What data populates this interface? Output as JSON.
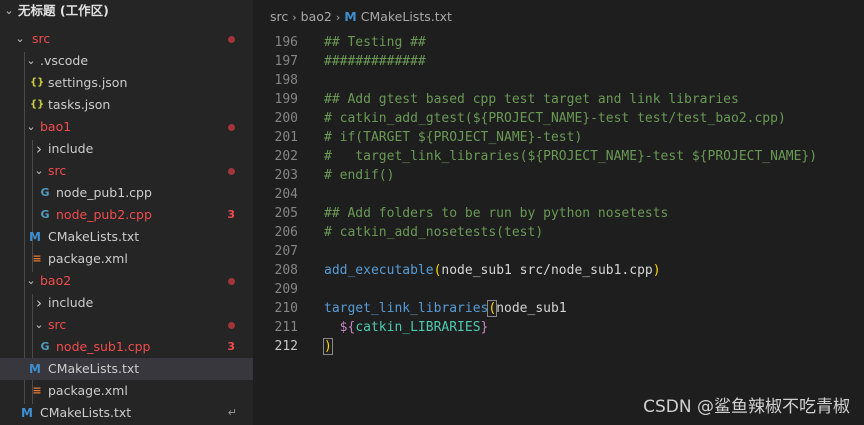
{
  "explorer": {
    "workspace_label": "无标题 (工作区)",
    "items": [
      {
        "label": "src",
        "color": "#f14c4c",
        "marker": "dot"
      },
      {
        "label": ".vscode"
      },
      {
        "label": "settings.json",
        "icon": "{ }"
      },
      {
        "label": "tasks.json",
        "icon": "{ }"
      },
      {
        "label": "bao1",
        "color": "#f14c4c",
        "marker": "dot"
      },
      {
        "label": "include"
      },
      {
        "label": "src",
        "color": "#f14c4c",
        "marker": "dot"
      },
      {
        "label": "node_pub1.cpp",
        "icon": "C"
      },
      {
        "label": "node_pub2.cpp",
        "icon": "C",
        "color": "#f14c4c",
        "badge": "3"
      },
      {
        "label": "CMakeLists.txt",
        "icon": "M"
      },
      {
        "label": "package.xml",
        "icon": "rss"
      },
      {
        "label": "bao2",
        "color": "#f14c4c",
        "marker": "dot"
      },
      {
        "label": "include"
      },
      {
        "label": "src",
        "color": "#f14c4c",
        "marker": "dot"
      },
      {
        "label": "node_sub1.cpp",
        "icon": "C",
        "color": "#f14c4c",
        "badge": "3"
      },
      {
        "label": "CMakeLists.txt",
        "icon": "M",
        "selected": true
      },
      {
        "label": "package.xml",
        "icon": "rss"
      },
      {
        "label": "CMakeLists.txt",
        "icon": "M",
        "trailing": "symlink"
      }
    ]
  },
  "breadcrumb": {
    "part1": "src",
    "part2": "bao2",
    "file": "CMakeLists.txt"
  },
  "code": [
    {
      "n": "196",
      "text": "## Testing ##"
    },
    {
      "n": "197",
      "text": "#############"
    },
    {
      "n": "198",
      "text": ""
    },
    {
      "n": "199",
      "text": "## Add gtest based cpp test target and link libraries"
    },
    {
      "n": "200",
      "text": "# catkin_add_gtest(${PROJECT_NAME}-test test/test_bao2.cpp)"
    },
    {
      "n": "201",
      "text": "# if(TARGET ${PROJECT_NAME}-test)"
    },
    {
      "n": "202",
      "text": "#   target_link_libraries(${PROJECT_NAME}-test ${PROJECT_NAME})"
    },
    {
      "n": "203",
      "text": "# endif()"
    },
    {
      "n": "204",
      "text": ""
    },
    {
      "n": "205",
      "text": "## Add folders to be run by python nosetests"
    },
    {
      "n": "206",
      "text": "# catkin_add_nosetests(test)"
    },
    {
      "n": "207",
      "text": ""
    },
    {
      "n": "208",
      "text": "add_executable(node_sub1 src/node_sub1.cpp)"
    },
    {
      "n": "209",
      "text": ""
    },
    {
      "n": "210",
      "text": "target_link_libraries(node_sub1"
    },
    {
      "n": "211",
      "text": "  ${catkin_LIBRARIES}"
    },
    {
      "n": "212",
      "text": ")"
    }
  ],
  "watermark": "CSDN @鲨鱼辣椒不吃青椒",
  "colors": {
    "comment": "#6a9955",
    "function": "#569cd6",
    "error_red": "#f14c4c",
    "selected_row": "#37373d"
  }
}
